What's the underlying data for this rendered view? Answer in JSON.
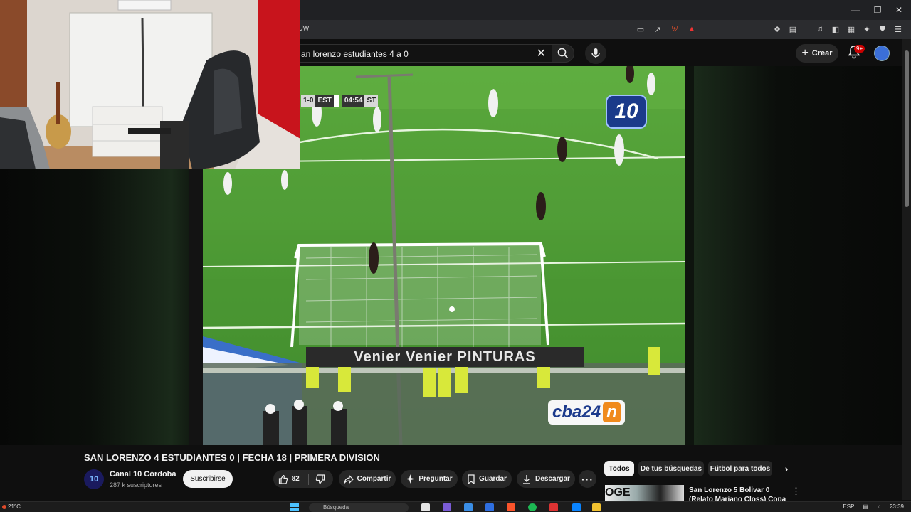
{
  "browser": {
    "url_text": "Uw"
  },
  "search": {
    "query": "an lorenzo estudiantes 4 a 0"
  },
  "header": {
    "create_label": "Crear",
    "notifications_badge": "9+"
  },
  "video_overlay": {
    "scorebug": [
      "1-0",
      "EST",
      "04:54",
      "ST"
    ],
    "channel_logo": "10",
    "ad_board": "Venier  Venier  PINTURAS",
    "broadcaster_logo_text": "cba24",
    "broadcaster_logo_badge": "n"
  },
  "video": {
    "title": "SAN LORENZO 4 ESTUDIANTES 0 | FECHA 18 | PRIMERA DIVISION",
    "channel_name": "Canal 10 Córdoba",
    "subscribers": "287 k suscriptores",
    "subscribe_label": "Suscribirse",
    "like_count": "82",
    "share_label": "Compartir",
    "ask_label": "Preguntar",
    "save_label": "Guardar",
    "download_label": "Descargar"
  },
  "chips": [
    "Todos",
    "De tus búsquedas",
    "Fútbol para todos"
  ],
  "recommendation": {
    "title": "San Lorenzo 5 Bolivar 0 (Relato Mariano Closs) Copa",
    "thumb_text": "OGE"
  },
  "taskbar": {
    "temperature": "21°C",
    "search_placeholder": "Búsqueda",
    "language": "ESP",
    "time": "23:39"
  },
  "colors": {
    "background": "#0f0f0f",
    "chip_active_bg": "#f1f1f1",
    "pill_bg": "#272727",
    "notification_red": "#cc0000"
  }
}
